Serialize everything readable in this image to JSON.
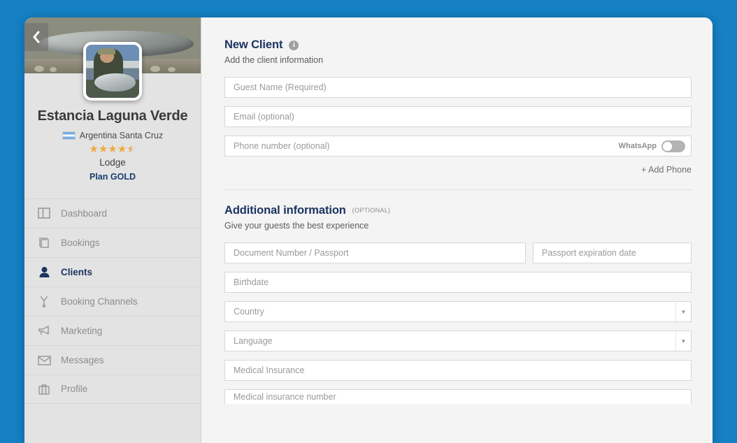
{
  "theme": {
    "frame_blue": "#1580c4",
    "sidebar_bg": "#e3e3e3",
    "main_bg": "#f4f4f4",
    "accent_navy": "#1b3461",
    "star_gold": "#f0a93b",
    "muted_text": "#8c8c8c"
  },
  "sidebar": {
    "back_icon": "chevron-left-icon",
    "avatar_alt": "profile-photo",
    "cover_alt": "cover-photo",
    "lodge_name": "Estancia Laguna Verde",
    "flag": "argentina-flag",
    "location": "Argentina Santa Cruz",
    "rating": 4.5,
    "rating_max": 5,
    "type": "Lodge",
    "plan": "Plan GOLD",
    "items": [
      {
        "label": "Dashboard",
        "icon": "dashboard-icon",
        "active": false
      },
      {
        "label": "Bookings",
        "icon": "book-icon",
        "active": false
      },
      {
        "label": "Clients",
        "icon": "person-icon",
        "active": true
      },
      {
        "label": "Booking Channels",
        "icon": "channels-icon",
        "active": false
      },
      {
        "label": "Marketing",
        "icon": "megaphone-icon",
        "active": false
      },
      {
        "label": "Messages",
        "icon": "envelope-icon",
        "active": false
      },
      {
        "label": "Profile",
        "icon": "briefcase-icon",
        "active": false
      }
    ]
  },
  "main": {
    "new_client": {
      "title": "New Client",
      "info_icon": "info-icon",
      "subtitle": "Add the client information",
      "fields": {
        "guest_name": "Guest Name (Required)",
        "email": "Email (optional)",
        "phone": "Phone number (optional)",
        "whatsapp_label": "WhatsApp",
        "whatsapp_on": false
      },
      "add_phone": "+ Add Phone"
    },
    "additional": {
      "title": "Additional information",
      "optional_tag": "(OPTIONAL)",
      "subtitle": "Give your guests the best experience",
      "fields": {
        "document": "Document Number / Passport",
        "passport_expiration": "Passport expiration date",
        "birthdate": "Birthdate",
        "country": "Country",
        "language": "Language",
        "medical_insurance": "Medical Insurance",
        "medical_insurance_number": "Medical insurance number"
      }
    }
  }
}
